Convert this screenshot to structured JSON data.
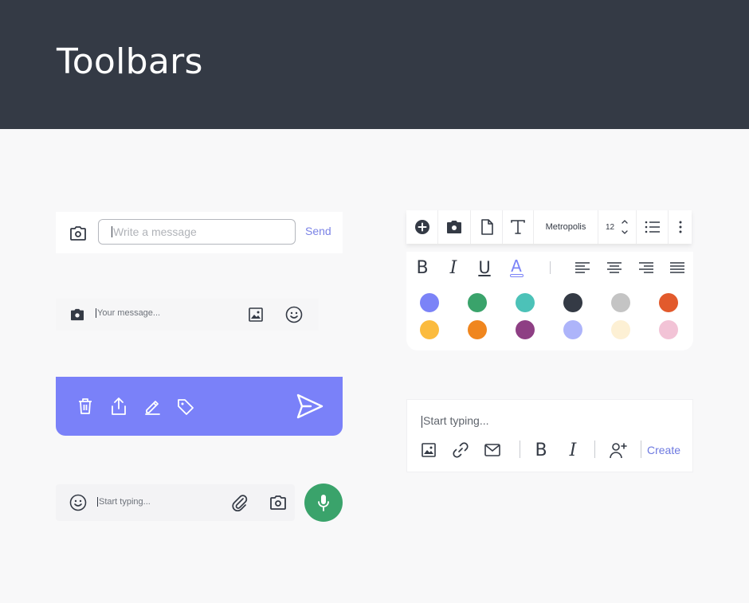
{
  "page": {
    "title": "Toolbars"
  },
  "colors": {
    "header_bg": "#343a45",
    "page_bg": "#f8f8f9",
    "accent": "#7a81f9",
    "link": "#7b83e6",
    "mic_green": "#3aa36b"
  },
  "message_toolbar": {
    "camera_icon": "camera-icon",
    "placeholder": "Write a message",
    "send_label": "Send"
  },
  "compact_toolbar": {
    "camera_icon": "camera-icon",
    "placeholder": "Your message...",
    "image_icon": "image-icon",
    "emoji_icon": "smiley-icon"
  },
  "action_toolbar": {
    "icons": [
      "trash-icon",
      "share-icon",
      "edit-icon",
      "tag-icon",
      "send-icon"
    ]
  },
  "voice_toolbar": {
    "emoji_icon": "smiley-icon",
    "placeholder": "Start typing...",
    "attach_icon": "paperclip-icon",
    "camera_icon": "camera-icon",
    "mic_icon": "microphone-icon"
  },
  "editor_toolbar": {
    "tools": [
      "add-icon",
      "camera-icon",
      "file-icon",
      "text-icon"
    ],
    "font_family": "Metropolis",
    "font_size": "12",
    "format": {
      "bold": "B",
      "italic": "I",
      "underline": "U",
      "color": "A"
    },
    "align": [
      "align-left-icon",
      "align-center-icon",
      "align-right-icon",
      "justify-icon"
    ],
    "swatches": [
      "#7b83f7",
      "#3aa36b",
      "#4cc2b8",
      "#343a45",
      "#c4c4c4",
      "#e25a2c",
      "#fbbb3e",
      "#f0861e",
      "#8e3f84",
      "#adb4fa",
      "#fdf0d4",
      "#f2c3d6"
    ]
  },
  "compose_box": {
    "placeholder": "Start typing...",
    "icons": [
      "image-icon",
      "link-icon",
      "mail-icon"
    ],
    "bold": "B",
    "italic": "I",
    "mention_icon": "add-person-icon",
    "create_label": "Create"
  }
}
